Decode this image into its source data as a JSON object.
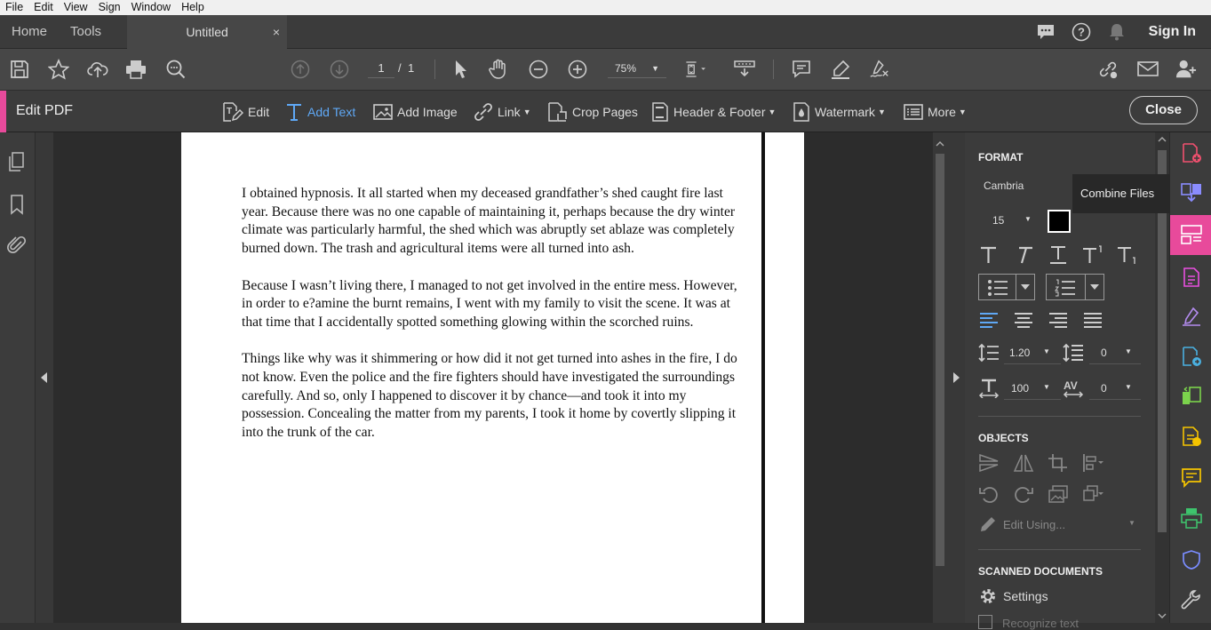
{
  "menu": [
    "File",
    "Edit",
    "View",
    "Sign",
    "Window",
    "Help"
  ],
  "tabs": {
    "home": "Home",
    "tools": "Tools",
    "doc": "Untitled",
    "close": "×"
  },
  "signin": "Sign In",
  "toolbar": {
    "page_current": "1",
    "page_sep": "/",
    "page_total": "1",
    "zoom": "75%"
  },
  "editbar": {
    "title": "Edit PDF",
    "edit": "Edit",
    "add_text": "Add Text",
    "add_image": "Add Image",
    "link": "Link",
    "crop": "Crop Pages",
    "header_footer": "Header & Footer",
    "watermark": "Watermark",
    "more": "More",
    "close": "Close"
  },
  "document": {
    "paragraphs": [
      "I obtained hypnosis. It all started when my deceased grandfather’s shed caught fire last year. Because there was no one capable of maintaining it, perhaps because the dry winter climate was particularly harmful, the shed which was abruptly set ablaze was completely burned down. The trash and agricultural items were all turned into ash.",
      "Because I wasn’t living there, I managed to not get involved in the entire mess. However, in order to e?amine the burnt remains, I went with my family to visit the scene. It was at that time that I accidentally spotted something glowing within the scorched ruins.",
      "Things like why was it shimmering or how did it not get turned into ashes in the fire, I do not know. Even the police and the fire fighters should have investigated the surroundings carefully. And so, only I happened to discover it by chance—and took it into my possession. Concealing the matter from my parents, I took it home by covertly slipping it into the trunk of the car."
    ]
  },
  "format": {
    "heading": "FORMAT",
    "font": "Cambria",
    "size": "15",
    "color": "#000000",
    "line_spacing": "1.20",
    "para_spacing": "0",
    "scale": "100",
    "tracking": "0"
  },
  "objects": {
    "heading": "OBJECTS",
    "edit_using": "Edit Using..."
  },
  "scanned": {
    "heading": "SCANNED DOCUMENTS",
    "settings": "Settings",
    "recognize": "Recognize text"
  },
  "tooltip": "Combine Files",
  "colors": {
    "accent": "#e84a9b",
    "active": "#5fa8f5"
  }
}
